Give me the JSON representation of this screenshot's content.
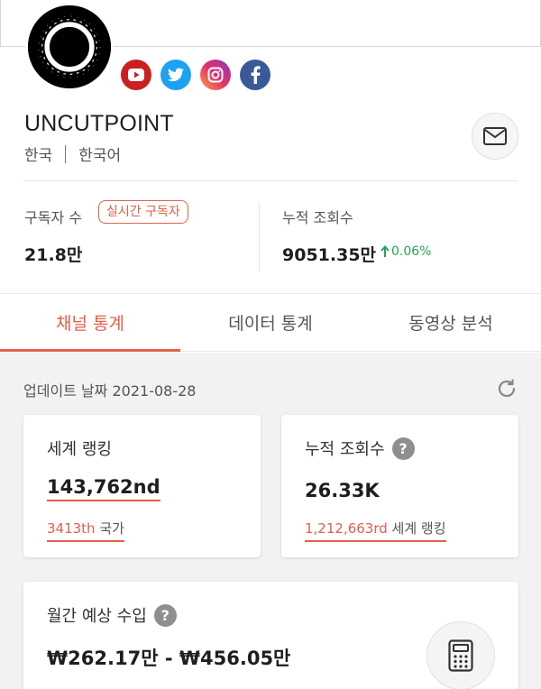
{
  "channel": {
    "name": "UNCUTPOINT",
    "country": "한국",
    "language": "한국어"
  },
  "socials": [
    {
      "name": "youtube",
      "color": "#cc1f1f"
    },
    {
      "name": "twitter",
      "color": "#1da1f2"
    },
    {
      "name": "instagram",
      "color": "#d62976"
    },
    {
      "name": "facebook",
      "color": "#3b5998"
    }
  ],
  "stats": {
    "subscribers_label": "구독자 수",
    "realtime_badge": "실시간 구독자",
    "subscribers_value": "21.8만",
    "views_label": "누적 조회수",
    "views_value": "9051.35만",
    "views_growth": "0.06%"
  },
  "tabs": [
    {
      "label": "채널 통계",
      "active": true
    },
    {
      "label": "데이터 통계",
      "active": false
    },
    {
      "label": "동영상 분석",
      "active": false
    }
  ],
  "update": {
    "text": "업데이트 날짜 2021-08-28"
  },
  "cards": {
    "world_rank": {
      "title": "세계 랭킹",
      "value": "143,762nd",
      "sub_value": "3413th",
      "sub_label": "국가"
    },
    "views": {
      "title": "누적 조회수",
      "value": "26.33K",
      "sub_value": "1,212,663rd",
      "sub_label": "세계 랭킹"
    },
    "revenue": {
      "title": "월간 예상 수입",
      "value": "₩262.17만 - ₩456.05만"
    }
  },
  "colors": {
    "accent": "#e2604a",
    "growth": "#2aa152"
  }
}
